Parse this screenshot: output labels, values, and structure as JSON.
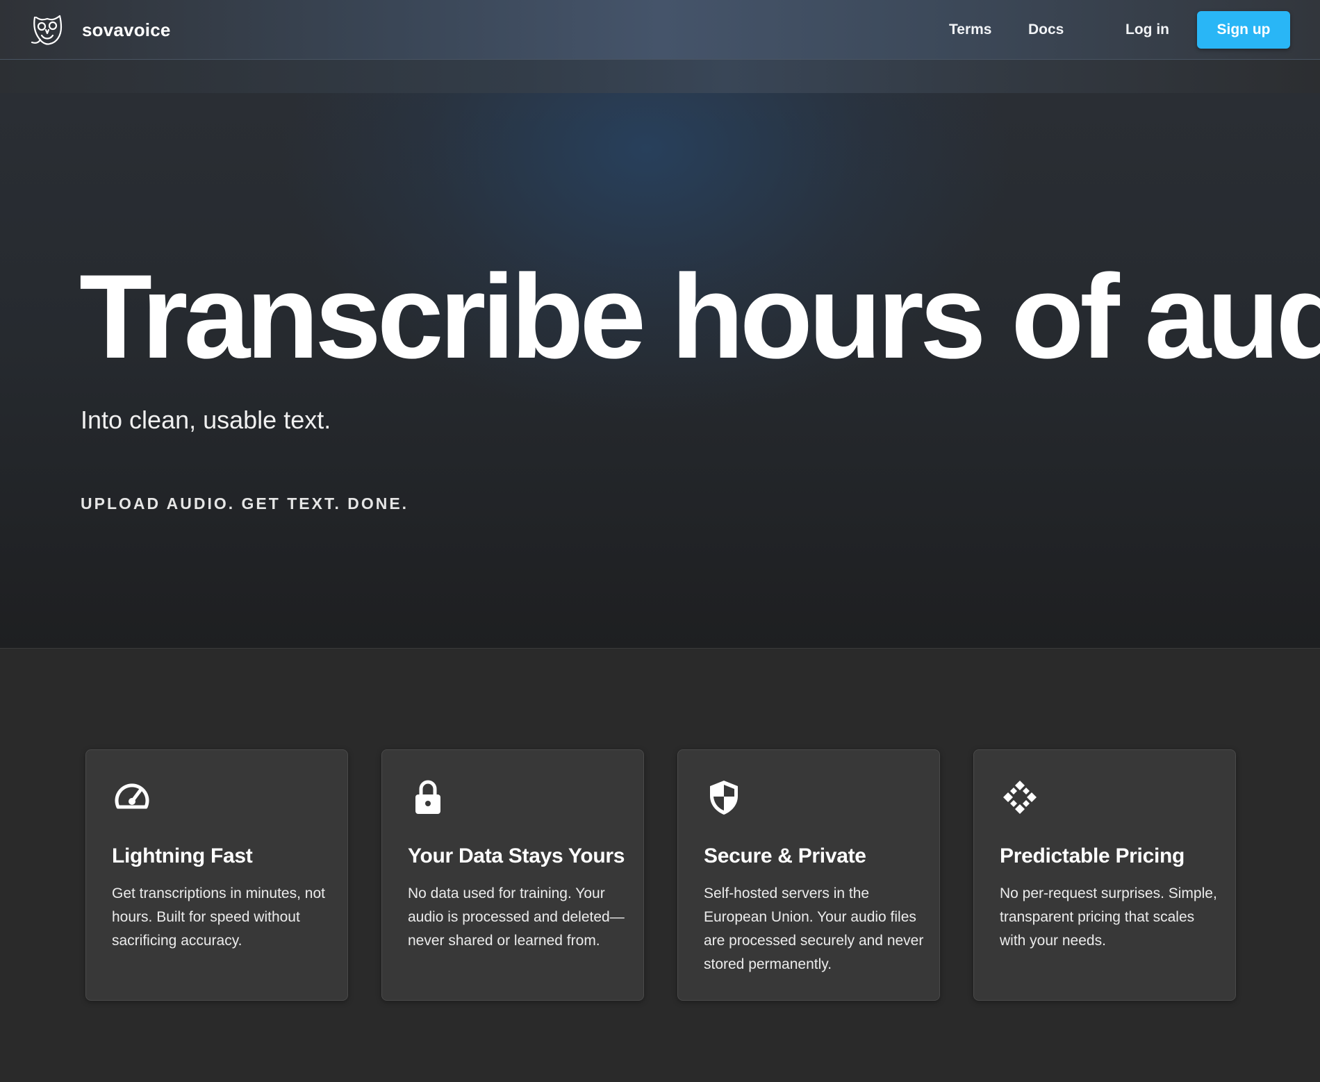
{
  "header": {
    "brand_name": "sovavoice",
    "logo_icon": "owl-logo-icon",
    "nav": {
      "terms": "Terms",
      "docs": "Docs",
      "login": "Log in",
      "signup": "Sign up"
    },
    "accent_color": "#29b6f6"
  },
  "hero": {
    "title": "Transcribe hours of audio",
    "subtitle": "Into clean, usable text.",
    "tagline": "UPLOAD AUDIO. GET TEXT. DONE."
  },
  "features": [
    {
      "icon": "speedometer-icon",
      "title": "Lightning Fast",
      "text": "Get transcriptions in minutes, not hours. Built for speed without sacrificing accuracy."
    },
    {
      "icon": "lock-icon",
      "title": "Your Data Stays Yours",
      "text": "No data used for training. Your audio is processed and deleted—never shared or learned from."
    },
    {
      "icon": "shield-icon",
      "title": "Secure & Private",
      "text": "Self-hosted servers in the European Union. Your audio files are processed securely and never stored permanently."
    },
    {
      "icon": "diamond-grid-icon",
      "title": "Predictable Pricing",
      "text": "No per-request surprises. Simple, transparent pricing that scales with your needs."
    }
  ]
}
